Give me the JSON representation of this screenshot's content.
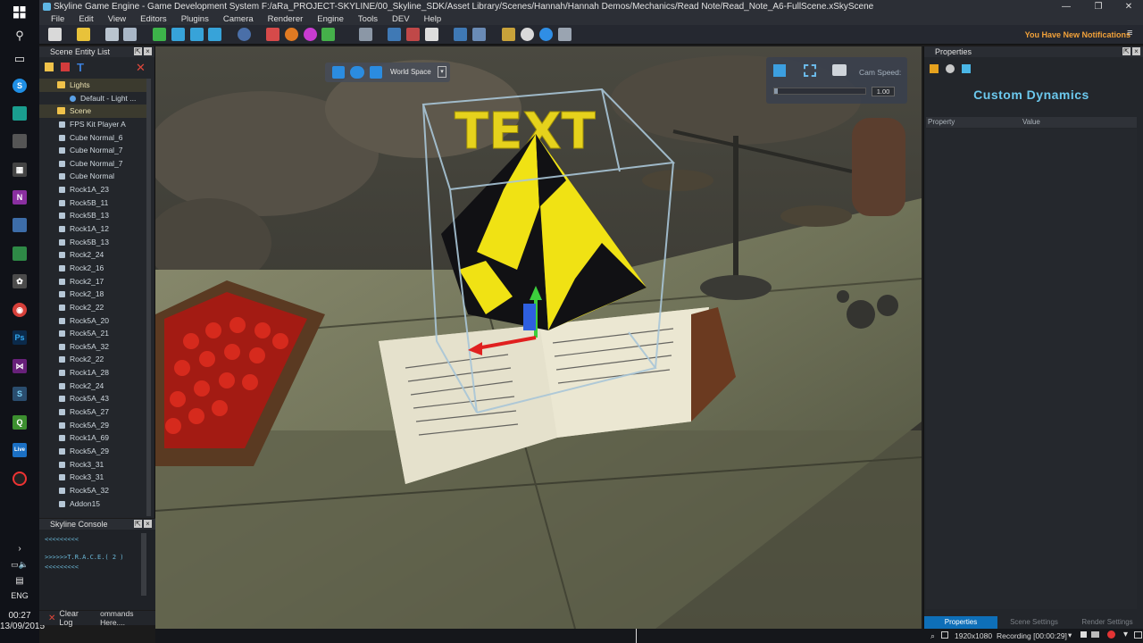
{
  "window": {
    "title": "Skyline Game Engine - Game Development System F:/aRa_PROJECT-SKYLINE/00_Skyline_SDK/Asset Library/Scenes/Hannah/Hannah Demos/Mechanics/Read Note/Read_Note_A6-FullScene.xSkyScene",
    "controls": [
      "—",
      "❐",
      "✕"
    ]
  },
  "menu": [
    "File",
    "Edit",
    "View",
    "Editors",
    "Plugins",
    "Camera",
    "Renderer",
    "Engine",
    "Tools",
    "DEV",
    "Help"
  ],
  "notifications": "You Have New Notifications",
  "scene_entity_list": {
    "title": "Scene Entity List",
    "items": [
      {
        "label": "Lights",
        "kind": "folder"
      },
      {
        "label": "Default - Light ...",
        "kind": "light"
      },
      {
        "label": "Scene",
        "kind": "folder"
      },
      {
        "label": "FPS Kit  Player A",
        "kind": "entity"
      },
      {
        "label": "Cube Normal_6",
        "kind": "entity"
      },
      {
        "label": "Cube Normal_7",
        "kind": "entity"
      },
      {
        "label": "Cube Normal_7",
        "kind": "entity"
      },
      {
        "label": "Cube Normal",
        "kind": "entity"
      },
      {
        "label": "Rock1A_23",
        "kind": "entity"
      },
      {
        "label": "Rock5B_11",
        "kind": "entity"
      },
      {
        "label": "Rock5B_13",
        "kind": "entity"
      },
      {
        "label": "Rock1A_12",
        "kind": "entity"
      },
      {
        "label": "Rock5B_13",
        "kind": "entity"
      },
      {
        "label": "Rock2_24",
        "kind": "entity"
      },
      {
        "label": "Rock2_16",
        "kind": "entity"
      },
      {
        "label": "Rock2_17",
        "kind": "entity"
      },
      {
        "label": "Rock2_18",
        "kind": "entity"
      },
      {
        "label": "Rock2_22",
        "kind": "entity"
      },
      {
        "label": "Rock5A_20",
        "kind": "entity"
      },
      {
        "label": "Rock5A_21",
        "kind": "entity"
      },
      {
        "label": "Rock5A_32",
        "kind": "entity"
      },
      {
        "label": "Rock2_22",
        "kind": "entity"
      },
      {
        "label": "Rock1A_28",
        "kind": "entity"
      },
      {
        "label": "Rock2_24",
        "kind": "entity"
      },
      {
        "label": "Rock5A_43",
        "kind": "entity"
      },
      {
        "label": "Rock5A_27",
        "kind": "entity"
      },
      {
        "label": "Rock5A_29",
        "kind": "entity"
      },
      {
        "label": "Rock1A_69",
        "kind": "entity"
      },
      {
        "label": "Rock5A_29",
        "kind": "entity"
      },
      {
        "label": "Rock3_31",
        "kind": "entity"
      },
      {
        "label": "Rock3_31",
        "kind": "entity"
      },
      {
        "label": "Rock5A_32",
        "kind": "entity"
      },
      {
        "label": "Addon15",
        "kind": "entity"
      }
    ]
  },
  "console": {
    "title": "Skyline Console",
    "lines": [
      "<<<<<<<<<",
      ">>>>>>T.R.A.C.E.( 2 )",
      "<<<<<<<<<"
    ],
    "clear_label": "Clear Log",
    "command_placeholder": "ommands Here...."
  },
  "viewport": {
    "space_label": "World Space",
    "cam_speed_label": "Cam Speed:",
    "cam_speed_value": "1.00",
    "scene_text": "TEXT"
  },
  "properties": {
    "title": "Properties",
    "heading": "Custom Dynamics",
    "col_property": "Property",
    "col_value": "Value",
    "tabs": [
      "Properties",
      "Scene Settings",
      "Render Settings"
    ],
    "active_tab": 0
  },
  "statusbar": {
    "resolution": "1920x1080",
    "recording": "Recording [00:00:29]"
  },
  "clock": {
    "time": "00:27",
    "date": "13/09/2015",
    "lang": "ENG"
  },
  "colors": {
    "accent": "#6cc9ee",
    "notify": "#f2a23a",
    "tab_active": "#0e6fb8"
  }
}
